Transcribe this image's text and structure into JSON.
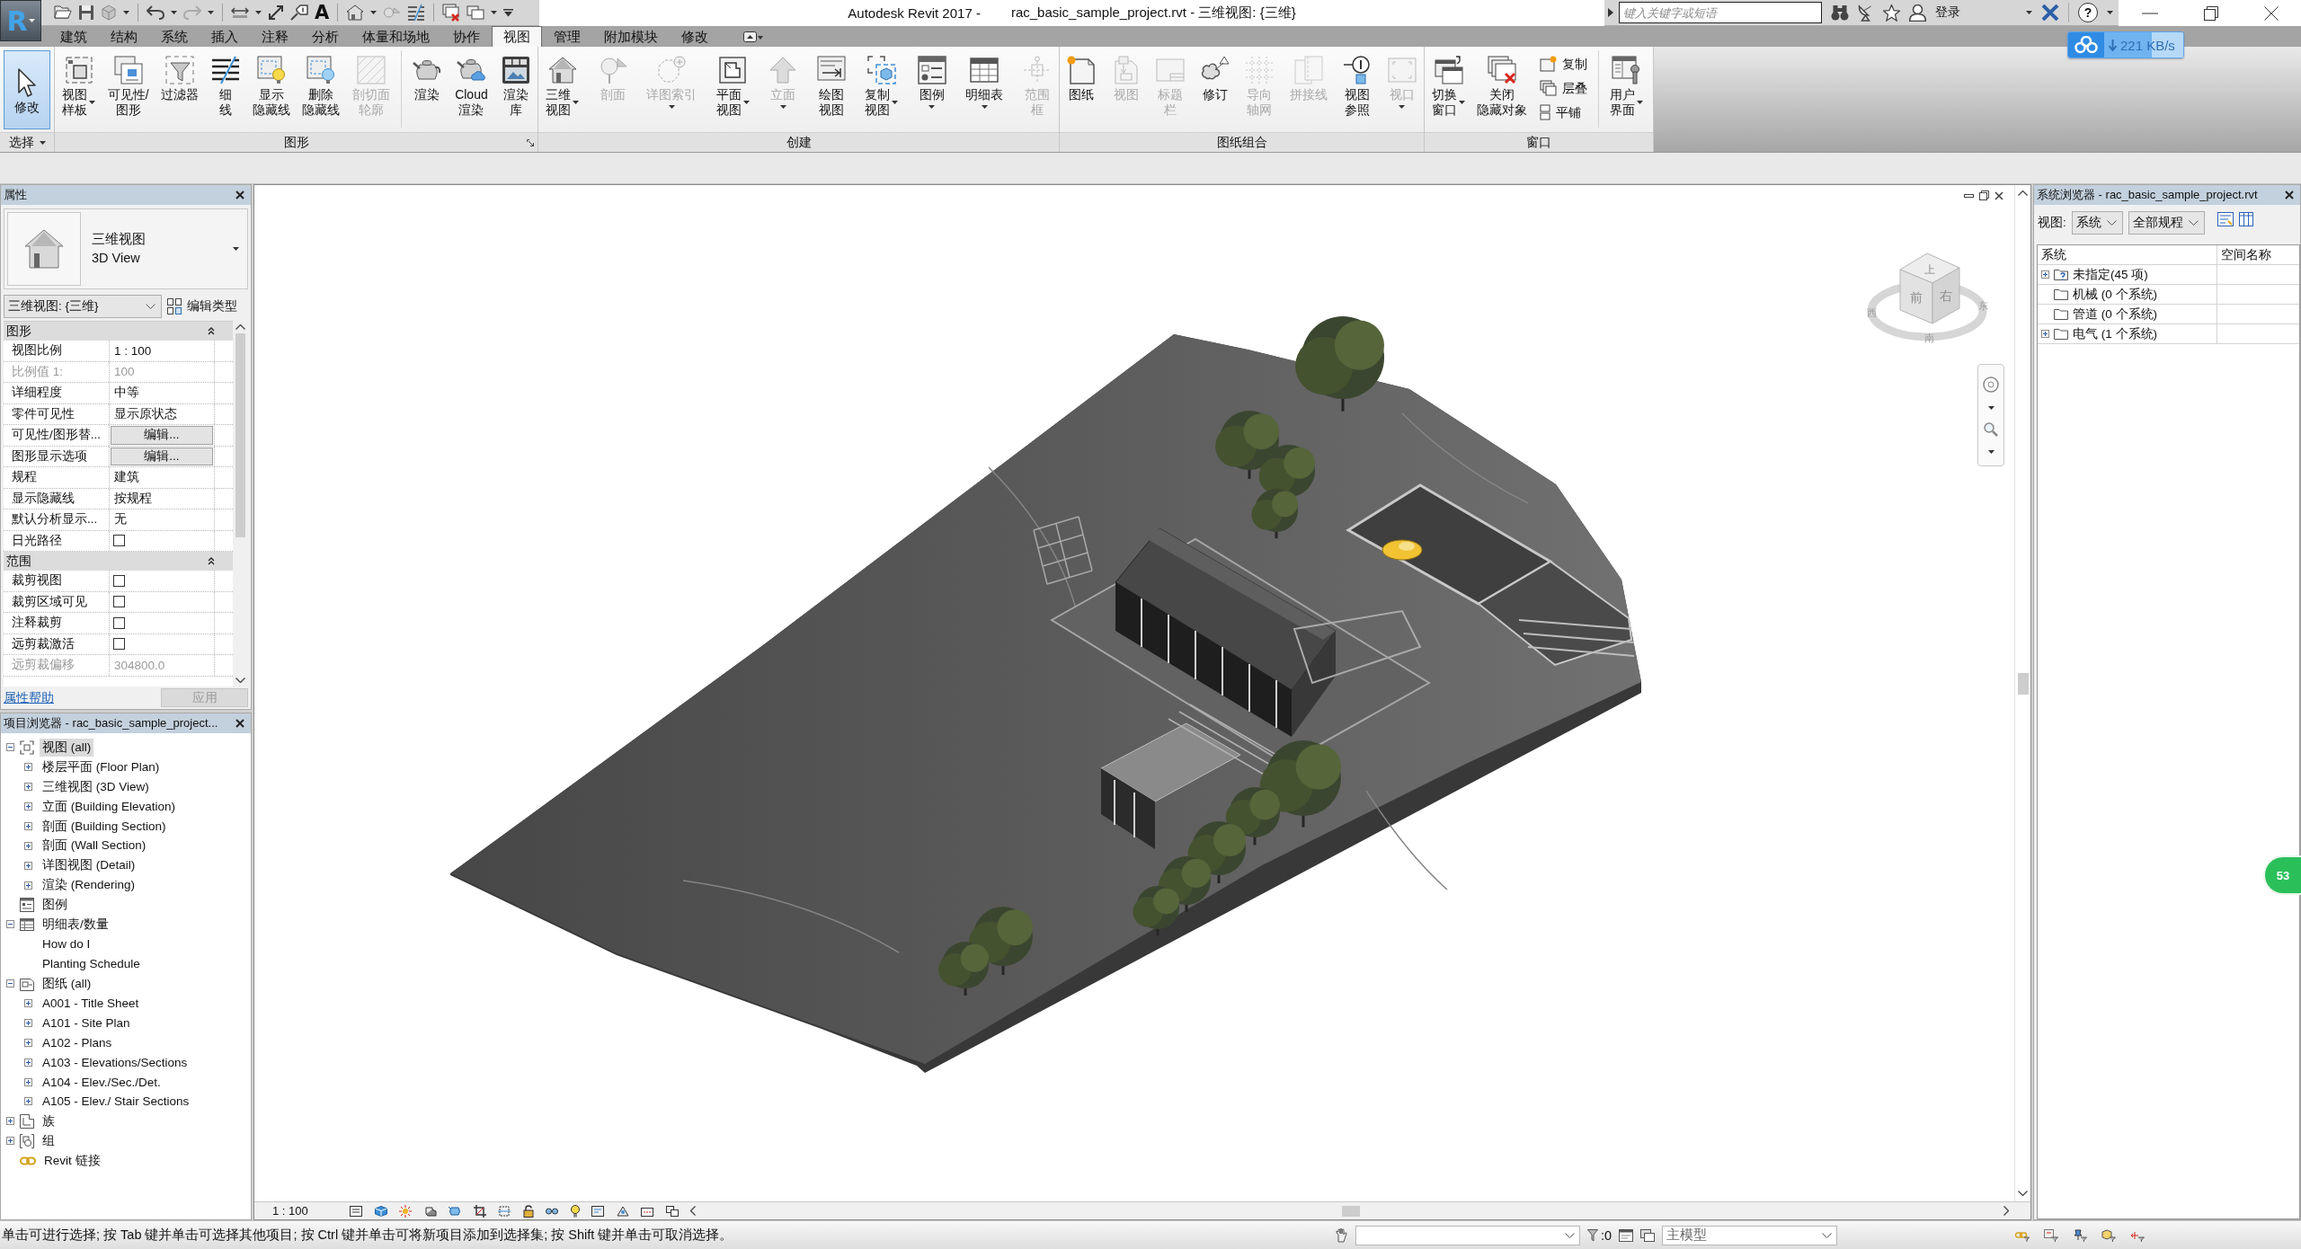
{
  "title_bar": {
    "app_letter": "R",
    "text_tool": "A",
    "app_title": "Autodesk Revit 2017 -",
    "document_title": "rac_basic_sample_project.rvt - 三维视图: {三维}",
    "search": {
      "placeholder": "键入关键字或短语"
    },
    "sign_in": "登录",
    "help": "?"
  },
  "download_badge": {
    "reading": "221 KB/s"
  },
  "ribbon": {
    "tabs": [
      {
        "label": "建筑",
        "selected": false
      },
      {
        "label": "结构",
        "selected": false
      },
      {
        "label": "系统",
        "selected": false
      },
      {
        "label": "插入",
        "selected": false
      },
      {
        "label": "注释",
        "selected": false
      },
      {
        "label": "分析",
        "selected": false
      },
      {
        "label": "体量和场地",
        "selected": false
      },
      {
        "label": "协作",
        "selected": false
      },
      {
        "label": "视图",
        "selected": true
      },
      {
        "label": "管理",
        "selected": false
      },
      {
        "label": "附加模块",
        "selected": false
      },
      {
        "label": "修改",
        "selected": false
      }
    ],
    "panels": [
      {
        "title": "选择",
        "menu": true,
        "launcher": false,
        "groups": [
          [
            {
              "label": "修改",
              "kind": "large",
              "active": true,
              "disabled": false,
              "dropdown": false
            }
          ]
        ]
      },
      {
        "title": "图形",
        "menu": false,
        "launcher": true,
        "groups": [
          [
            {
              "label": "视图样板",
              "kind": "large",
              "active": false,
              "disabled": false,
              "dropdown": true
            },
            {
              "label": "可见性/图形",
              "kind": "large",
              "active": false,
              "disabled": false,
              "dropdown": false
            },
            {
              "label": "过滤器",
              "kind": "large",
              "active": false,
              "disabled": false,
              "dropdown": false
            },
            {
              "label": "细线",
              "kind": "large",
              "active": false,
              "disabled": false,
              "dropdown": false
            },
            {
              "label": "显示隐藏线",
              "kind": "large",
              "active": false,
              "disabled": false,
              "dropdown": false
            },
            {
              "label": "删除隐藏线",
              "kind": "large",
              "active": false,
              "disabled": false,
              "dropdown": false
            },
            {
              "label": "剖切面轮廓",
              "kind": "large",
              "active": false,
              "disabled": true,
              "dropdown": false
            }
          ],
          [
            {
              "label": "渲染",
              "kind": "large",
              "active": false,
              "disabled": false,
              "dropdown": false
            },
            {
              "label": "Cloud 渲染",
              "kind": "large",
              "active": false,
              "disabled": false,
              "dropdown": false
            },
            {
              "label": "渲染库",
              "kind": "large",
              "active": false,
              "disabled": false,
              "dropdown": false
            }
          ]
        ]
      },
      {
        "title": "创建",
        "menu": false,
        "launcher": false,
        "groups": [
          [
            {
              "label": "三维视图",
              "kind": "large",
              "active": false,
              "disabled": false,
              "dropdown": true
            },
            {
              "label": "剖面",
              "kind": "large",
              "active": false,
              "disabled": true,
              "dropdown": false
            },
            {
              "label": "详图索引",
              "kind": "large",
              "active": false,
              "disabled": true,
              "dropdown": true
            },
            {
              "label": "平面视图",
              "kind": "large",
              "active": false,
              "disabled": false,
              "dropdown": true
            },
            {
              "label": "立面",
              "kind": "large",
              "active": false,
              "disabled": true,
              "dropdown": true
            },
            {
              "label": "绘图视图",
              "kind": "large",
              "active": false,
              "disabled": false,
              "dropdown": false
            },
            {
              "label": "复制视图",
              "kind": "large",
              "active": false,
              "disabled": false,
              "dropdown": true
            },
            {
              "label": "图例",
              "kind": "large",
              "active": false,
              "disabled": false,
              "dropdown": true
            },
            {
              "label": "明细表",
              "kind": "large",
              "active": false,
              "disabled": false,
              "dropdown": true
            },
            {
              "label": "范围框",
              "kind": "large",
              "active": false,
              "disabled": true,
              "dropdown": false
            }
          ]
        ]
      },
      {
        "title": "图纸组合",
        "menu": false,
        "launcher": false,
        "groups": [
          [
            {
              "label": "图纸",
              "kind": "large",
              "active": false,
              "disabled": false,
              "dropdown": false
            },
            {
              "label": "视图",
              "kind": "large",
              "active": false,
              "disabled": true,
              "dropdown": false
            },
            {
              "label": "标题栏",
              "kind": "large",
              "active": false,
              "disabled": true,
              "dropdown": false
            },
            {
              "label": "修订",
              "kind": "large",
              "active": false,
              "disabled": false,
              "dropdown": false
            },
            {
              "label": "导向轴网",
              "kind": "large",
              "active": false,
              "disabled": true,
              "dropdown": false
            },
            {
              "label": "拼接线",
              "kind": "large",
              "active": false,
              "disabled": true,
              "dropdown": false
            },
            {
              "label": "视图参照",
              "kind": "large",
              "active": false,
              "disabled": false,
              "dropdown": false
            },
            {
              "label": "视口",
              "kind": "large",
              "active": false,
              "disabled": true,
              "dropdown": true
            }
          ]
        ]
      },
      {
        "title": "窗口",
        "menu": false,
        "launcher": false,
        "groups": [
          [
            {
              "label": "切换窗口",
              "kind": "large",
              "active": false,
              "disabled": false,
              "dropdown": true
            },
            {
              "label": "关闭隐藏对象",
              "kind": "large",
              "active": false,
              "disabled": false,
              "dropdown": false
            },
            {
              "label": "复制",
              "kind": "small",
              "active": false,
              "disabled": false,
              "dropdown": false
            },
            {
              "label": "层叠",
              "kind": "small",
              "active": false,
              "disabled": false,
              "dropdown": false
            },
            {
              "label": "平铺",
              "kind": "small",
              "active": false,
              "disabled": false,
              "dropdown": false
            }
          ],
          [
            {
              "label": "用户界面",
              "kind": "large",
              "active": false,
              "disabled": false,
              "dropdown": true
            }
          ]
        ]
      }
    ]
  },
  "properties": {
    "title": "属性",
    "type_selector": {
      "name": "三维视图",
      "subname": "3D View"
    },
    "instance": "三维视图: {三维}",
    "edit_type": "编辑类型",
    "groups": [
      {
        "title": "图形",
        "rows": [
          {
            "kind": "text",
            "name": "视图比例",
            "value": "1 : 100",
            "disabled": false
          },
          {
            "kind": "text",
            "name": "比例值 1:",
            "value": "100",
            "disabled": true
          },
          {
            "kind": "text",
            "name": "详细程度",
            "value": "中等",
            "disabled": false
          },
          {
            "kind": "text",
            "name": "零件可见性",
            "value": "显示原状态",
            "disabled": false
          },
          {
            "kind": "button",
            "name": "可见性/图形替...",
            "value": "编辑...",
            "disabled": false
          },
          {
            "kind": "button",
            "name": "图形显示选项",
            "value": "编辑...",
            "disabled": false
          },
          {
            "kind": "text",
            "name": "规程",
            "value": "建筑",
            "disabled": false
          },
          {
            "kind": "text",
            "name": "显示隐藏线",
            "value": "按规程",
            "disabled": false
          },
          {
            "kind": "text",
            "name": "默认分析显示...",
            "value": "无",
            "disabled": false
          },
          {
            "kind": "checkbox",
            "name": "日光路径",
            "checked": false,
            "disabled": false
          }
        ]
      },
      {
        "title": "范围",
        "rows": [
          {
            "kind": "checkbox",
            "name": "裁剪视图",
            "checked": false,
            "disabled": false
          },
          {
            "kind": "checkbox",
            "name": "裁剪区域可见",
            "checked": false,
            "disabled": false
          },
          {
            "kind": "checkbox",
            "name": "注释裁剪",
            "checked": false,
            "disabled": false
          },
          {
            "kind": "checkbox",
            "name": "远剪裁激活",
            "checked": false,
            "disabled": false
          },
          {
            "kind": "text",
            "name": "远剪裁偏移",
            "value": "304800.0",
            "disabled": true
          }
        ]
      }
    ],
    "help_link": "属性帮助",
    "apply": {
      "label": "应用",
      "disabled": true
    }
  },
  "project_browser": {
    "title": "项目浏览器 - rac_basic_sample_project...",
    "tree": [
      {
        "label": "视图 (all)",
        "kind": "views",
        "expanded": true,
        "selected": true,
        "children": [
          {
            "label": "楼层平面 (Floor Plan)",
            "expanded": false,
            "selected": false
          },
          {
            "label": "三维视图 (3D View)",
            "expanded": false,
            "selected": false
          },
          {
            "label": "立面 (Building Elevation)",
            "expanded": false,
            "selected": false
          },
          {
            "label": "剖面 (Building Section)",
            "expanded": false,
            "selected": false
          },
          {
            "label": "剖面 (Wall Section)",
            "expanded": false,
            "selected": false
          },
          {
            "label": "详图视图 (Detail)",
            "expanded": false,
            "selected": false
          },
          {
            "label": "渲染 (Rendering)",
            "expanded": false,
            "selected": false
          }
        ]
      },
      {
        "label": "图例",
        "kind": "legends",
        "selected": false
      },
      {
        "label": "明细表/数量",
        "kind": "schedules",
        "expanded": true,
        "selected": false,
        "children": [
          {
            "label": "How do I",
            "selected": false
          },
          {
            "label": "Planting Schedule",
            "selected": false
          }
        ]
      },
      {
        "label": "图纸 (all)",
        "kind": "sheets",
        "expanded": true,
        "selected": false,
        "children": [
          {
            "label": "A001 - Title Sheet",
            "expanded": false,
            "selected": false
          },
          {
            "label": "A101 - Site Plan",
            "expanded": false,
            "selected": false
          },
          {
            "label": "A102 - Plans",
            "expanded": false,
            "selected": false
          },
          {
            "label": "A103 - Elevations/Sections",
            "expanded": false,
            "selected": false
          },
          {
            "label": "A104 - Elev./Sec./Det.",
            "expanded": false,
            "selected": false
          },
          {
            "label": "A105 - Elev./ Stair Sections",
            "expanded": false,
            "selected": false
          }
        ]
      },
      {
        "label": "族",
        "kind": "families",
        "expanded": false,
        "selected": false
      },
      {
        "label": "组",
        "kind": "groups",
        "expanded": false,
        "selected": false
      },
      {
        "label": "Revit 链接",
        "kind": "links",
        "selected": false
      }
    ]
  },
  "view": {
    "viewcube": {
      "top": "上",
      "front": "前",
      "right": "右",
      "west": "西",
      "east": "东",
      "south": "南"
    },
    "scale": "1 : 100"
  },
  "system_browser": {
    "title": "系统浏览器 - rac_basic_sample_project.rvt",
    "view_label": "视图:",
    "view_select": "系统",
    "discipline_select": "全部规程",
    "columns": [
      "系统",
      "空间名称"
    ],
    "rows": [
      {
        "name": "未指定(45 项)",
        "kind": "unassigned",
        "expanded": false
      },
      {
        "name": "机械 (0 个系统)",
        "kind": "system"
      },
      {
        "name": "管道 (0 个系统)",
        "kind": "system"
      },
      {
        "name": "电气 (1 个系统)",
        "kind": "system",
        "expanded": false
      }
    ]
  },
  "status_bar": {
    "message": "单击可进行选择; 按 Tab 键并单击可选择其他项目; 按 Ctrl 键并单击可将新项目添加到选择集; 按 Shift 键并单击可取消选择。",
    "filter_count": ":0",
    "model": "主模型"
  },
  "side_badge": "53"
}
